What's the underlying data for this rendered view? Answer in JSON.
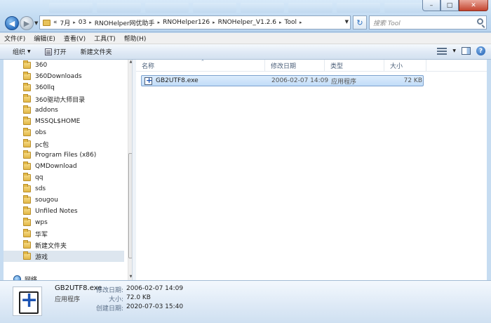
{
  "address": {
    "overflow": "«",
    "crumbs": [
      "7月",
      "03",
      "RNOHelper网优助手",
      "RNOHelper126",
      "RNOHelper_V1.2.6",
      "Tool"
    ]
  },
  "search": {
    "placeholder": "搜索 Tool"
  },
  "menu": {
    "file": "文件(F)",
    "edit": "编辑(E)",
    "view": "查看(V)",
    "tools": "工具(T)",
    "help": "帮助(H)"
  },
  "toolbar": {
    "organize": "组织",
    "open": "打开",
    "new_folder": "新建文件夹"
  },
  "sidebar": {
    "items": [
      {
        "label": "360"
      },
      {
        "label": "360Downloads"
      },
      {
        "label": "360llq"
      },
      {
        "label": "360驱动大师目录"
      },
      {
        "label": "addons"
      },
      {
        "label": "MSSQL$HOME"
      },
      {
        "label": "obs"
      },
      {
        "label": "pc包"
      },
      {
        "label": "Program Files (x86)"
      },
      {
        "label": "QMDownload"
      },
      {
        "label": "qq"
      },
      {
        "label": "sds"
      },
      {
        "label": "sougou"
      },
      {
        "label": "Unfiled Notes"
      },
      {
        "label": "wps"
      },
      {
        "label": "华军"
      },
      {
        "label": "新建文件夹"
      },
      {
        "label": "游戏"
      }
    ],
    "selected": "游戏",
    "network": "网络"
  },
  "columns": {
    "name": "名称",
    "modified": "修改日期",
    "type": "类型",
    "size": "大小"
  },
  "files": [
    {
      "name": "GB2UTF8.exe",
      "modified": "2006-02-07 14:09",
      "type": "应用程序",
      "size": "72 KB"
    }
  ],
  "details": {
    "name": "GB2UTF8.exe",
    "type": "应用程序",
    "modified_label": "修改日期:",
    "modified": "2006-02-07 14:09",
    "size_label": "大小:",
    "size": "72.0 KB",
    "created_label": "创建日期:",
    "created": "2020-07-03 15:40"
  },
  "icons": {
    "back": "back-arrow-icon",
    "forward": "forward-arrow-icon",
    "refresh": "refresh-icon",
    "search": "search-icon",
    "folder": "folder-icon",
    "exe": "application-icon",
    "views": "views-icon",
    "preview_pane": "preview-pane-icon",
    "help": "help-icon"
  },
  "colors": {
    "selection": "#c1dcf8",
    "selection_border": "#7da2ce",
    "accent": "#2a6fc0"
  }
}
